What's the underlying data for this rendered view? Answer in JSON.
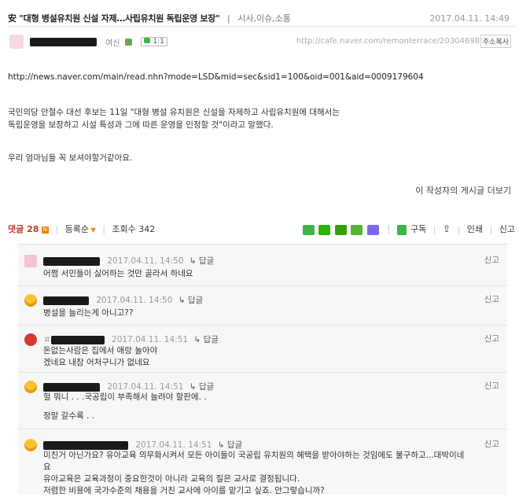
{
  "post": {
    "title": "安 \"대형 병설유치원 신설 자제…사립유치원 독립운영 보장\"",
    "category": "시사,이슈,소통",
    "date": "2017.04.11. 14:49",
    "author_grade": "여신",
    "chat_label": "1:1",
    "url": "http://cafe.naver.com/remonterrace/20304698",
    "copy_button": "주소복사",
    "link": "http://news.naver.com/main/read.nhn?mode=LSD&mid=sec&sid1=100&oid=001&aid=0009179604",
    "paragraph1_line1": "국민의당 안철수 대선 후보는 11일 \"대형 병설 유치원은 신설을 자제하고 사립유치원에 대해서는",
    "paragraph1_line2": "독립운영을 보장하고 시설 특성과 그에 따른 운영을 인정할 것\"이라고 말했다.",
    "paragraph2": "우리 엄마님들 꼭 보셔야할거같아요.",
    "more_link": "이 작성자의 게시글 더보기"
  },
  "comment_bar": {
    "label": "댓글 28",
    "new_badge": "N",
    "sort": "등록순",
    "views": "조회수 342",
    "subscribe": "구독",
    "print": "인쇄",
    "report": "신고"
  },
  "comments": [
    {
      "date": "2017.04.11. 14:50",
      "reply": "답글",
      "report": "신고",
      "lines": [
        "어쩜 서민들이 싫어하는 것만 골라서 하네요"
      ]
    },
    {
      "date": "2017.04.11. 14:50",
      "reply": "답글",
      "report": "신고",
      "lines": [
        "병설을 늘리는게 아니고??"
      ]
    },
    {
      "prefix": "ㅍ",
      "date": "2017.04.11. 14:51",
      "reply": "답글",
      "report": "신고",
      "lines": [
        "돈없는사람은 집에서 애랑 놀아야",
        "겠네요 내참 어처구니가 없네요"
      ]
    },
    {
      "date": "2017.04.11. 14:51",
      "reply": "답글",
      "report": "신고",
      "lines": [
        "헐 뭐니 . . .국공립이 부족해서 늘려야 할판에. .",
        "",
        "정말 갈수록 . ."
      ]
    },
    {
      "date": "2017.04.11. 14:51",
      "reply": "답글",
      "report": "신고",
      "lines": [
        "미친거 아닌가요? 유아교육 의무화시켜서 모든 아이들이 국공립 유치원의 혜택을 받아야하는 것임에도 불구하고...대박이네",
        "요",
        "유아교육은 교육과정이 중요한것이 아니라 교육의 질은 교사로 결정됩니다.",
        "저렴한 비용에 국가수준의 채용을 거친 교사에 아이를 맡기고 싶죠. 안그렇습니까?"
      ]
    }
  ]
}
